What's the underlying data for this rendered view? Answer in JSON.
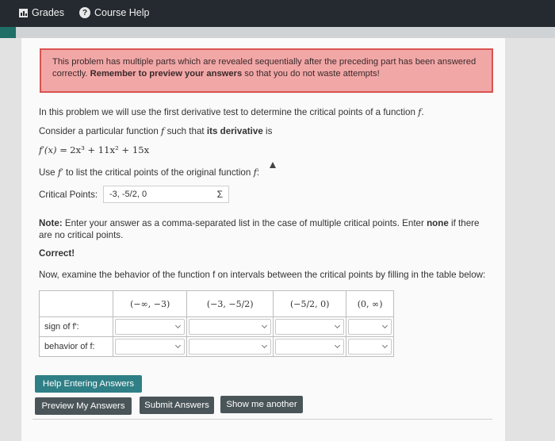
{
  "nav": {
    "grades_label": "Grades",
    "course_help_label": "Course Help"
  },
  "alert": {
    "text_1": "This problem has multiple parts which are revealed sequentially after the preceding part has been answered correctly.",
    "text_bold": "Remember to preview your answers",
    "text_2": "so that you do not waste attempts!"
  },
  "problem": {
    "intro_1": "In this problem we will use the first derivative test to determine the critical points of a function",
    "f": "f",
    "consider_1": "Consider a particular function",
    "consider_2": "such that",
    "consider_bold": "its derivative",
    "consider_3": "is",
    "deriv_lhs": "f′(x) =",
    "deriv_rhs": "2x³ + 11x² + 15x",
    "use_1": "Use",
    "fprime": "f′",
    "use_2": "to list the critical points of the original function",
    "critical_label": "Critical Points:",
    "critical_value": "-3, -5/2, 0",
    "sigma": "Σ",
    "note_bold": "Note:",
    "note_text": "Enter your answer as a comma-separated list in the case of multiple critical points. Enter",
    "note_none": "none",
    "note_text_2": "if there are no critical points.",
    "correct": "Correct!",
    "examine": "Now, examine the behavior of the function f on intervals between the critical points by filling in the table below:"
  },
  "table": {
    "intervals": [
      "(−∞, −3)",
      "(−3, −5/2)",
      "(−5/2, 0)",
      "(0, ∞)"
    ],
    "row_sign": "sign of f′:",
    "row_behavior": "behavior of f:",
    "sign_values": [
      "",
      "",
      "",
      ""
    ],
    "behavior_values": [
      "",
      "",
      "",
      ""
    ]
  },
  "buttons": {
    "help_entering": "Help Entering Answers",
    "preview": "Preview My Answers",
    "submit": "Submit Answers",
    "show_another": "Show me another"
  },
  "colors": {
    "topbar": "#242a2f",
    "alert_bg": "#f2a7a7",
    "alert_border": "#d9534f",
    "teal_button": "#2f7f86",
    "dark_button": "#4a5559"
  }
}
